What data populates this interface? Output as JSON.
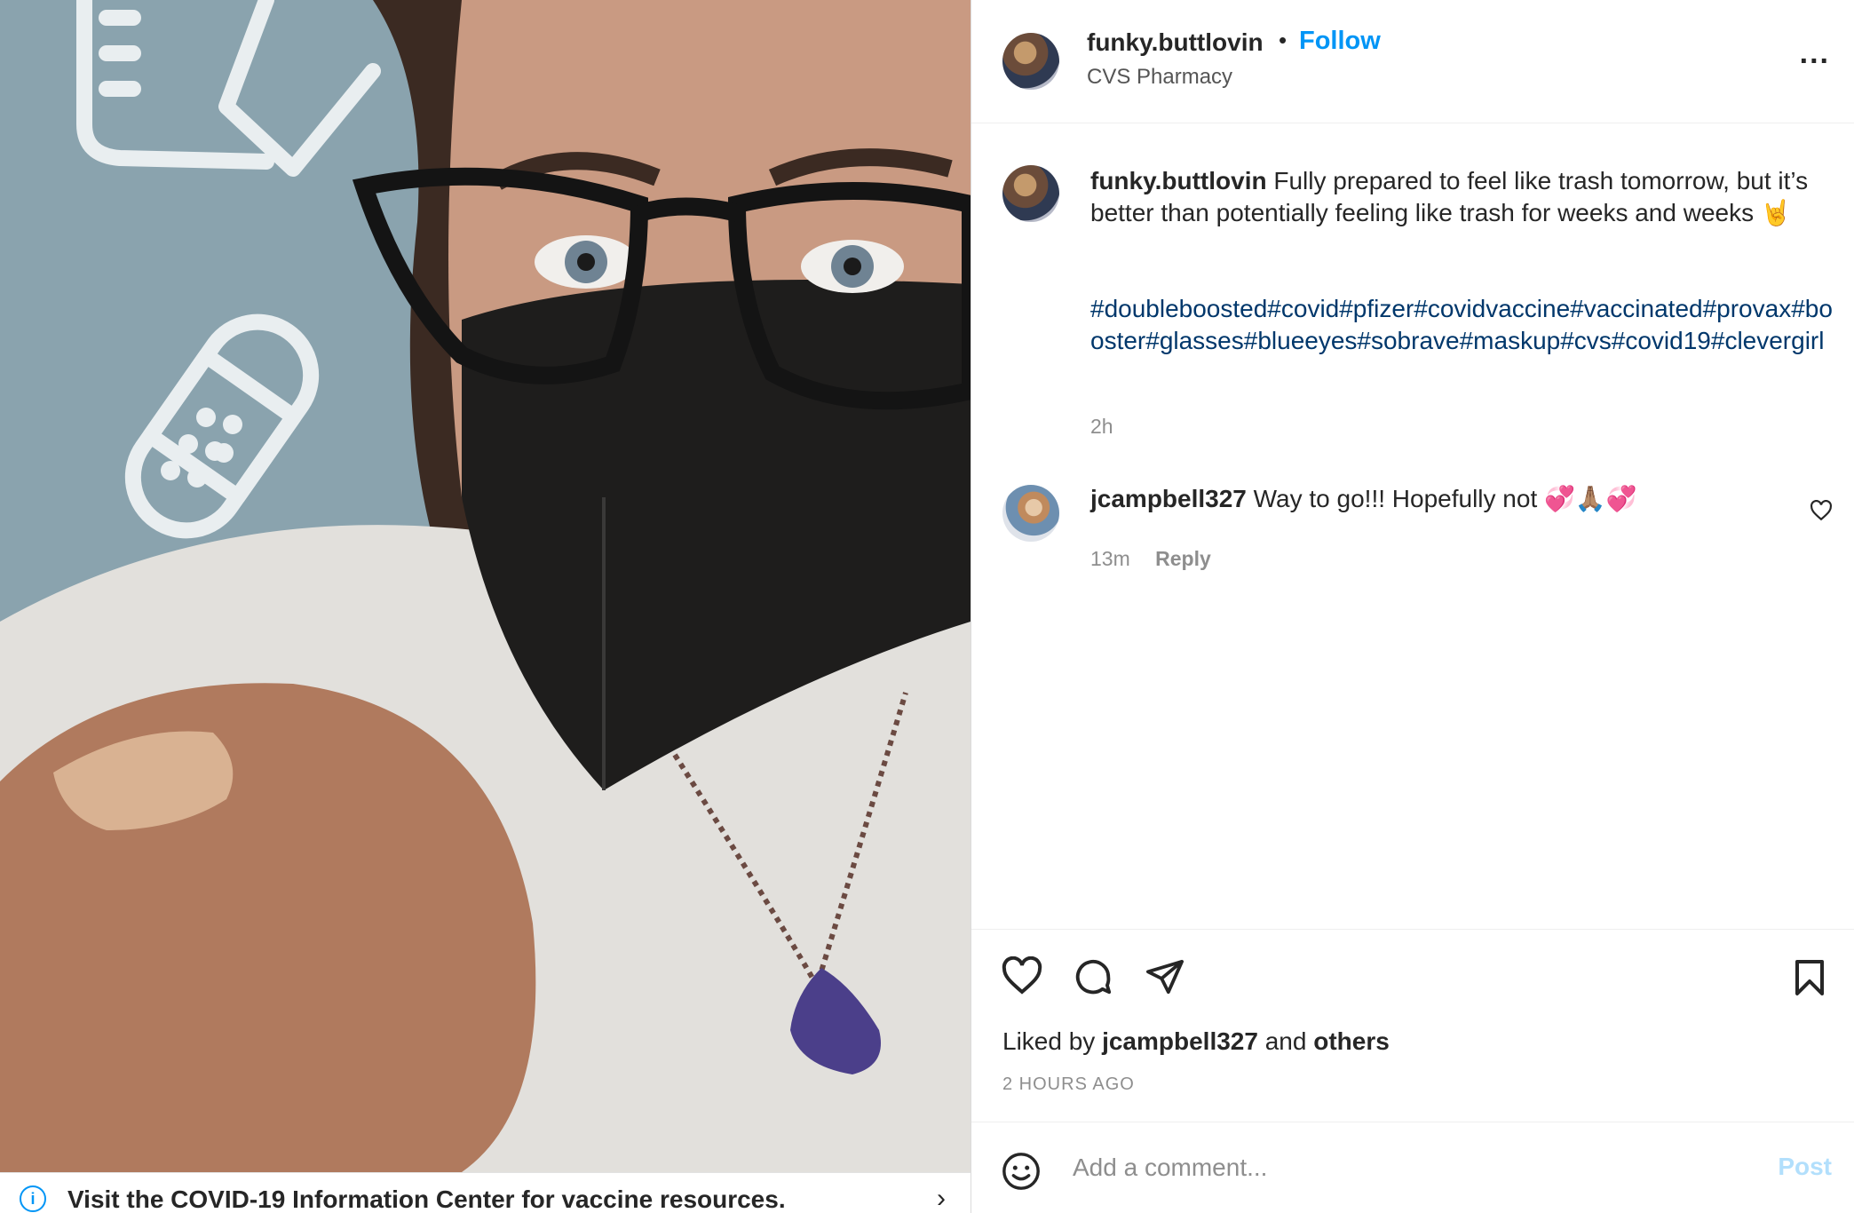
{
  "banner": {
    "info_icon": "info-icon",
    "text": "Visit the COVID-19 Information Center for vaccine resources.",
    "chevron": "›"
  },
  "post": {
    "username": "funky.buttlovin",
    "separator": "•",
    "follow_label": "Follow",
    "location": "CVS Pharmacy",
    "more_label": "...",
    "caption": {
      "username": "funky.buttlovin",
      "text": "Fully prepared to feel like trash tomorrow, but it’s better than potentially feeling like trash for weeks and weeks 🤘",
      "hashtags": "#doubleboosted#covid#pfizer#covidvaccine#vaccinated#provax#booster#glasses#blueeyes#sobrave#maskup#cvs#covid19#clevergirl",
      "time": "2h"
    },
    "comments": [
      {
        "username": "jcampbell327",
        "text": "Way to go!!! Hopefully not 💞🙏🏽💞",
        "time": "13m",
        "reply_label": "Reply"
      }
    ],
    "liked_by": {
      "prefix": "Liked by",
      "user": "jcampbell327",
      "middle": "and",
      "others": "others"
    },
    "age": "2 HOURS AGO",
    "add_comment": {
      "placeholder": "Add a comment...",
      "post_label": "Post"
    }
  },
  "colors": {
    "accent": "#0095f6",
    "hashtag": "#00376b",
    "muted": "#8e8e8e",
    "post_disabled": "#b2dffc"
  }
}
